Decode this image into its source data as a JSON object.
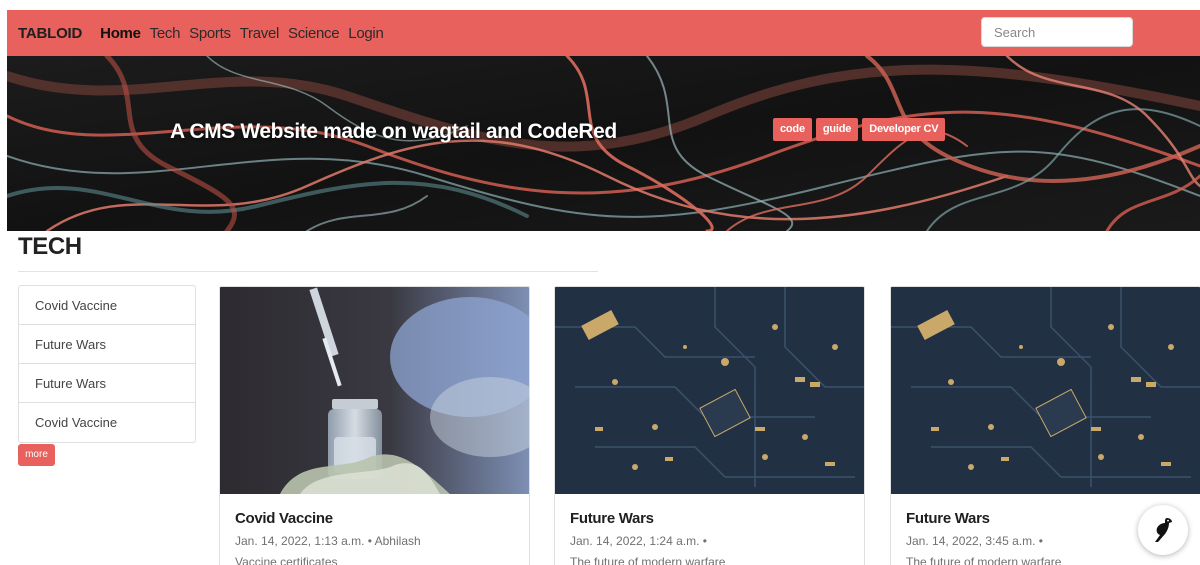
{
  "navbar": {
    "brand": "TABLOID",
    "links": [
      {
        "label": "Home",
        "active": true
      },
      {
        "label": "Tech",
        "active": false
      },
      {
        "label": "Sports",
        "active": false
      },
      {
        "label": "Travel",
        "active": false
      },
      {
        "label": "Science",
        "active": false
      },
      {
        "label": "Login",
        "active": false
      }
    ],
    "search_placeholder": "Search"
  },
  "hero": {
    "title": "A CMS Website made on wagtail and CodeRed",
    "tags": [
      "code",
      "guide",
      "Developer CV"
    ]
  },
  "section": {
    "title": "TECH"
  },
  "sidebar": {
    "items": [
      "Covid Vaccine",
      "Future Wars",
      "Future Wars",
      "Covid Vaccine"
    ],
    "more_label": "more"
  },
  "cards": [
    {
      "title": "Covid Vaccine",
      "meta": "Jan. 14, 2022, 1:13 a.m. • Abhilash",
      "desc": "Vaccine certificates",
      "image": "vaccine-vial-photo"
    },
    {
      "title": "Future Wars",
      "meta": "Jan. 14, 2022, 1:24 a.m. •",
      "desc": "The future of modern warfare",
      "image": "circuit-board-photo"
    },
    {
      "title": "Future Wars",
      "meta": "Jan. 14, 2022, 3:45 a.m. •",
      "desc": "The future of modern warfare",
      "image": "circuit-board-photo"
    }
  ],
  "colors": {
    "accent": "#e8615c",
    "text_dark": "#1f1f1f",
    "text_muted": "#707070"
  },
  "fab": {
    "icon": "wagtail-bird-icon"
  }
}
